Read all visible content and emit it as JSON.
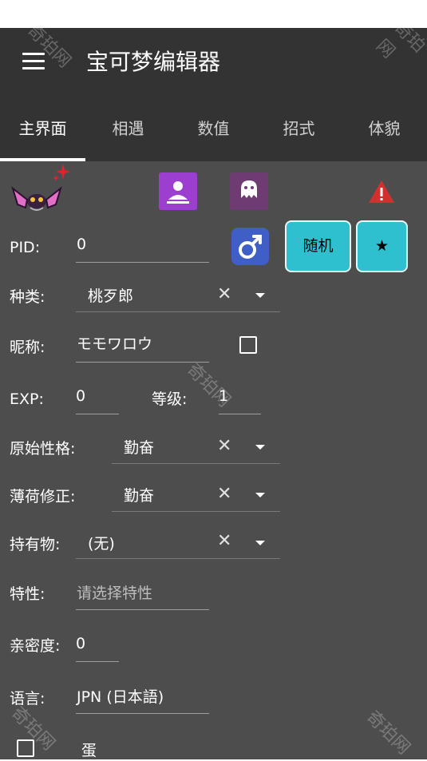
{
  "app": {
    "title": "宝可梦编辑器"
  },
  "tabs": [
    {
      "label": "主界面",
      "active": true
    },
    {
      "label": "相遇",
      "active": false
    },
    {
      "label": "数值",
      "active": false
    },
    {
      "label": "招式",
      "active": false
    },
    {
      "label": "体貌",
      "active": false
    }
  ],
  "header_icons": {
    "pokemon_sprite": "bat-pokemon-sprite-icon",
    "shiny": "shiny-sparkle-icon",
    "box": "person-box-icon",
    "ghost": "ghost-icon",
    "warning": "warning-icon",
    "gender": "male-gender-icon"
  },
  "buttons": {
    "random": "随机",
    "star": "★"
  },
  "form": {
    "pid": {
      "label": "PID:",
      "value": "0"
    },
    "species": {
      "label": "种类:",
      "value": "桃歹郎"
    },
    "nickname": {
      "label": "昵称:",
      "value": "モモワロウ"
    },
    "exp": {
      "label": "EXP:",
      "value": "0"
    },
    "level": {
      "label": "等级:",
      "value": "1"
    },
    "nature": {
      "label": "原始性格:",
      "value": "勤奋"
    },
    "mint": {
      "label": "薄荷修正:",
      "value": "勤奋"
    },
    "held_item": {
      "label": "持有物:",
      "value": "(无)"
    },
    "ability": {
      "label": "特性:",
      "placeholder": "请选择特性"
    },
    "friendship": {
      "label": "亲密度:",
      "value": "0"
    },
    "language": {
      "label": "语言:",
      "value": "JPN (日本語)"
    },
    "egg": {
      "label": "蛋"
    }
  },
  "watermark": "奇珀网",
  "colors": {
    "accent": "#2fc0cf",
    "appbar": "#333333",
    "content": "#4d4d4d",
    "warning": "#d32f2f"
  }
}
